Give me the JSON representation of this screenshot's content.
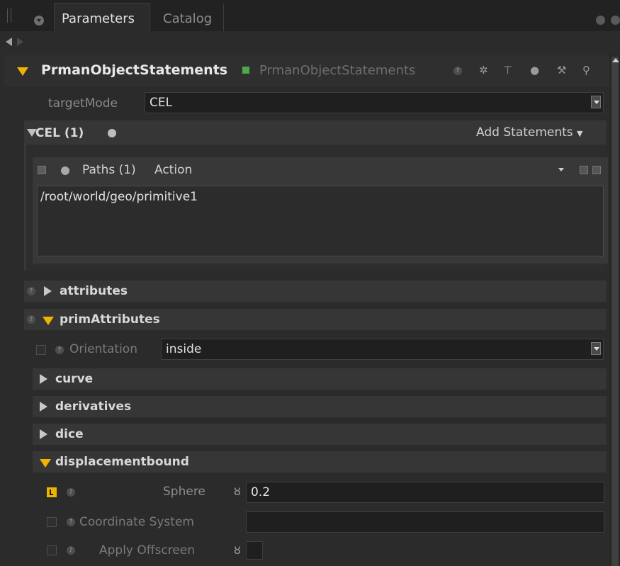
{
  "tabs": [
    {
      "label": "Parameters",
      "active": true
    },
    {
      "label": "Catalog",
      "active": false
    }
  ],
  "node": {
    "name": "PrmanObjectStatements",
    "type": "PrmanObjectStatements",
    "state_color": "#4ca84c"
  },
  "header_icons": [
    "help-icon",
    "gear-icon",
    "graph-icon",
    "comment-icon",
    "wrench-icon",
    "search-icon"
  ],
  "target_mode": {
    "label": "targetMode",
    "value": "CEL"
  },
  "cel_group": {
    "label": "CEL (1)",
    "add_statements": "Add Statements"
  },
  "paths": {
    "label": "Paths (1)",
    "action": "Action",
    "value": "/root/world/geo/primitive1"
  },
  "groups": {
    "attributes": "attributes",
    "prim_attributes": "primAttributes",
    "curve": "curve",
    "derivatives": "derivatives",
    "dice": "dice",
    "displacementbound": "displacementbound"
  },
  "orientation": {
    "label": "Orientation",
    "value": "inside"
  },
  "displacement": {
    "sphere_label": "Sphere",
    "sphere_value": "0.2",
    "coord_label": "Coordinate System",
    "coord_value": "",
    "offscreen_label": "Apply Offscreen"
  },
  "colors": {
    "accent": "#f0b400",
    "panel_bg": "#2b2b2b"
  }
}
